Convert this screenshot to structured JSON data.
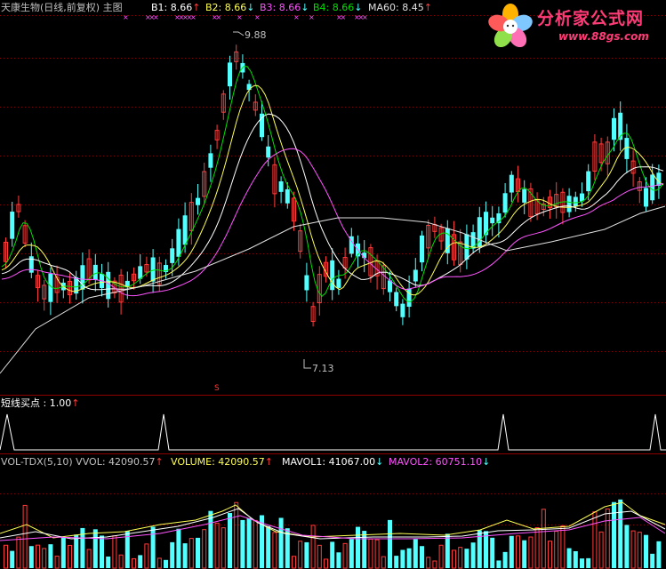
{
  "colors": {
    "up": "#ff3c3c",
    "down": "#54ffff",
    "grid": "#8c0000",
    "ma1": "#ffffff",
    "ma2": "#ffff54",
    "ma3": "#ff54ff",
    "ma4": "#00e000",
    "ma60": "#e0e0e0",
    "signal": "#ffffff",
    "mark": "#ff54ff"
  },
  "main_panel": {
    "title": "天康生物(日线,前复权) 主图",
    "indicators": [
      {
        "label": "B1: 8.66",
        "arrow": "↑",
        "color": "#ffffff",
        "arrow_color": "#ff3c3c"
      },
      {
        "label": "B2: 8.66",
        "arrow": "↓",
        "color": "#ffff54",
        "arrow_color": "#54ffff"
      },
      {
        "label": "B3: 8.66",
        "arrow": "↓",
        "color": "#ff54ff",
        "arrow_color": "#54ffff"
      },
      {
        "label": "B4: 8.66",
        "arrow": "↓",
        "color": "#00e000",
        "arrow_color": "#54ffff"
      },
      {
        "label": "MA60: 8.45",
        "arrow": "↑",
        "color": "#e0e0e0",
        "arrow_color": "#ff3c3c"
      }
    ],
    "high_label": "9.88",
    "low_label": "7.13",
    "marker_glyph": "×",
    "s_marker": "S"
  },
  "signal_panel": {
    "title": "短线买点 : 1.00",
    "arrow": "↑"
  },
  "volume_panel": {
    "indicators": [
      {
        "label": "VOL-TDX(5,10) VVOL: 42090.57",
        "arrow": "↑",
        "color": "#c0c0c0",
        "arrow_color": "#ff3c3c"
      },
      {
        "label": "VOLUME: 42090.57",
        "arrow": "↑",
        "color": "#ffff54",
        "arrow_color": "#ff3c3c"
      },
      {
        "label": "MAVOL1: 41067.00",
        "arrow": "↓",
        "color": "#ffffff",
        "arrow_color": "#54ffff"
      },
      {
        "label": "MAVOL2: 60751.10",
        "arrow": "↓",
        "color": "#ff54ff",
        "arrow_color": "#54ffff"
      }
    ]
  },
  "logo": {
    "text": "分析家公式网",
    "url_text": "www.88gs.com"
  }
}
